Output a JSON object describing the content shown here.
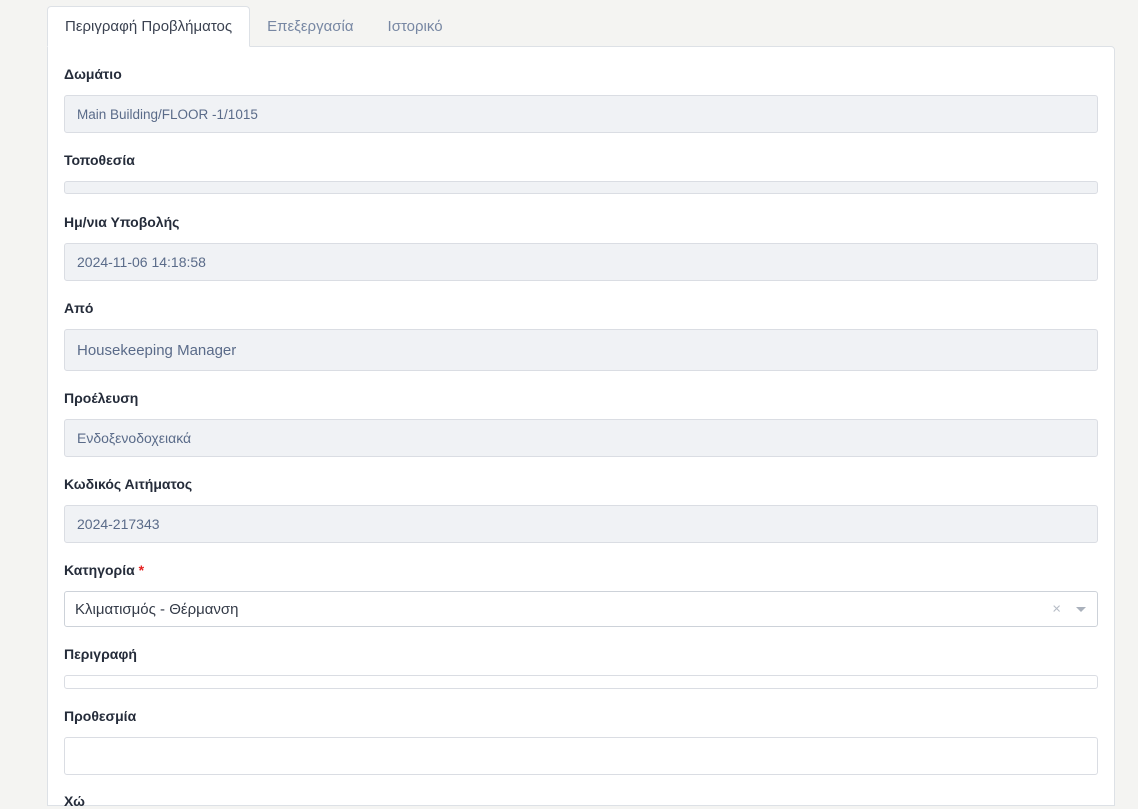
{
  "tabs": [
    {
      "label": "Περιγραφή Προβλήματος",
      "active": true
    },
    {
      "label": "Επεξεργασία",
      "active": false
    },
    {
      "label": "Ιστορικό",
      "active": false
    }
  ],
  "form": {
    "room": {
      "label": "Δωμάτιο",
      "value": "Main Building/FLOOR -1/1015"
    },
    "location": {
      "label": "Τοποθεσία",
      "value": ""
    },
    "submit_date": {
      "label": "Ημ/νια Υποβολής",
      "value": "2024-11-06 14:18:58"
    },
    "from": {
      "label": "Από",
      "value": "Housekeeping Manager"
    },
    "origin": {
      "label": "Προέλευση",
      "value": "Ενδοξενοδοχειακά"
    },
    "request_code": {
      "label": "Κωδικός Αιτήματος",
      "value": "2024-217343"
    },
    "category": {
      "label": "Κατηγορία",
      "required_mark": "*",
      "value": "Κλιματισμός - Θέρμανση",
      "clear_symbol": "×"
    },
    "description": {
      "label": "Περιγραφή",
      "value": ""
    },
    "deadline": {
      "label": "Προθεσμία",
      "value": ""
    },
    "next_label_partial": "Χώ"
  }
}
